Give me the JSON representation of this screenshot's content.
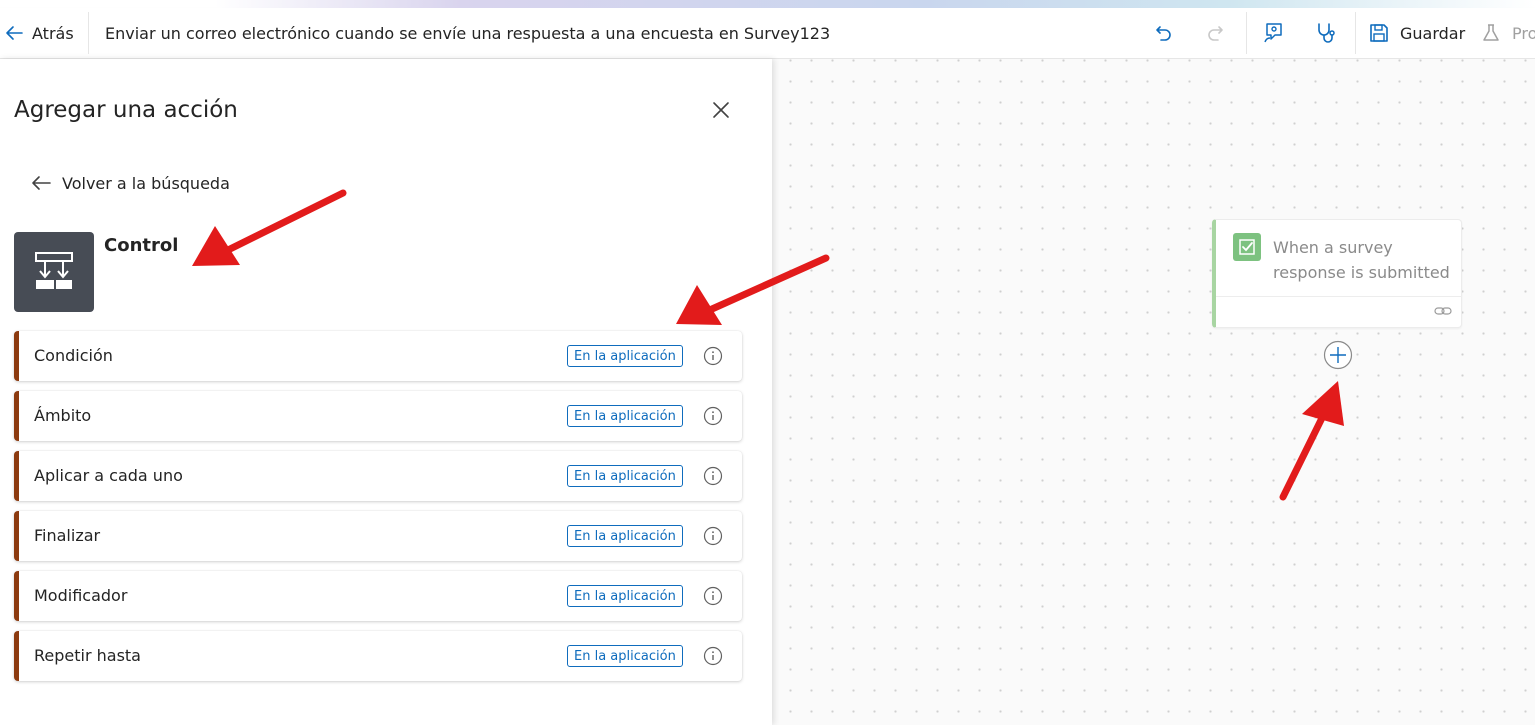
{
  "header": {
    "back_label": "Atrás",
    "flow_title": "Enviar un correo electrónico cuando se envíe una respuesta a una encuesta en Survey123",
    "save_label": "Guardar",
    "test_label": "Pro"
  },
  "panel": {
    "title": "Agregar una acción",
    "back_to_search": "Volver a la búsqueda",
    "connector_name": "Control",
    "actions": [
      {
        "name": "Condición",
        "badge": "En la aplicación"
      },
      {
        "name": "Ámbito",
        "badge": "En la aplicación"
      },
      {
        "name": "Aplicar a cada uno",
        "badge": "En la aplicación"
      },
      {
        "name": "Finalizar",
        "badge": "En la aplicación"
      },
      {
        "name": "Modificador",
        "badge": "En la aplicación"
      },
      {
        "name": "Repetir hasta",
        "badge": "En la aplicación"
      }
    ]
  },
  "canvas": {
    "trigger_title": "When a survey response is submitted"
  },
  "colors": {
    "accent": "#0f6cbd",
    "control_tile": "#474c55",
    "action_stripe": "#8c3a0f",
    "trigger_green": "#67b86b",
    "annotation_red": "#e21b1b"
  },
  "icons": [
    "back-arrow-icon",
    "undo-icon",
    "redo-icon",
    "copilot-icon",
    "flow-checker-icon",
    "save-icon",
    "test-flask-icon",
    "close-icon",
    "control-icon",
    "info-icon",
    "survey-icon",
    "link-icon",
    "add-step-icon"
  ]
}
